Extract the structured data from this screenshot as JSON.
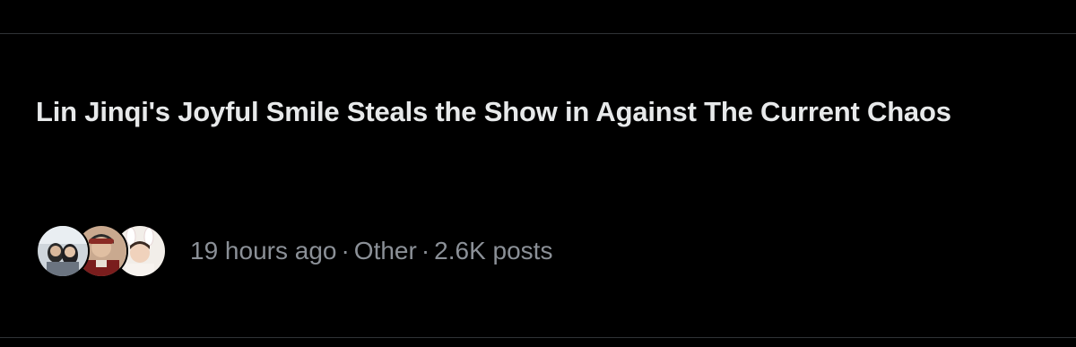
{
  "trend": {
    "headline": "Lin Jinqi's Joyful Smile Steals the Show in Against The Current Chaos",
    "time_ago": "19 hours ago",
    "category": "Other",
    "post_count": "2.6K posts",
    "separator": "·"
  },
  "avatars": [
    {
      "icon": "user-avatar-photo-1"
    },
    {
      "icon": "user-avatar-photo-2"
    },
    {
      "icon": "user-avatar-photo-3"
    }
  ],
  "colors": {
    "background": "#000000",
    "headline_text": "#e7e9ea",
    "meta_text": "#8b9097",
    "divider": "#2f3336"
  }
}
